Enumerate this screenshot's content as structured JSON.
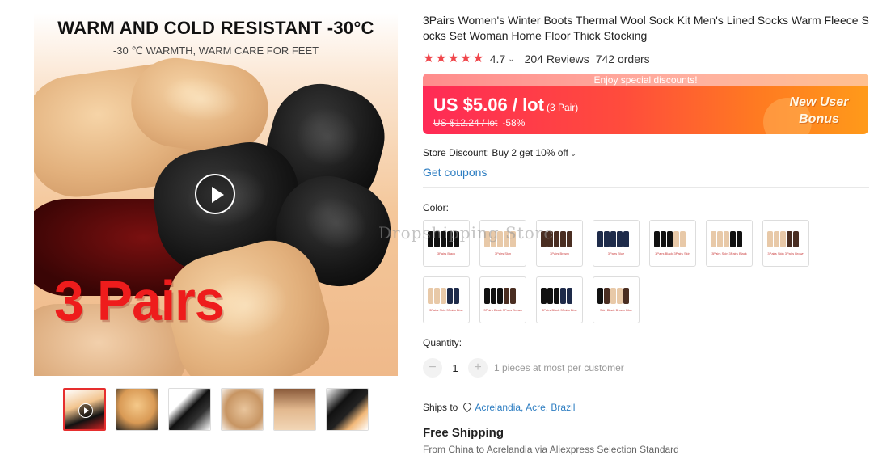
{
  "gallery": {
    "hero_title": "WARM AND COLD RESISTANT -30°C",
    "hero_subtitle": "-30 ℃ WARMTH, WARM CARE FOR FEET",
    "hero_overlay": "3 Pairs",
    "thumbnails": [
      "video",
      "beige-sock",
      "black-sock",
      "beige-sock-2",
      "socks-feet",
      "black-beige-sock"
    ]
  },
  "product": {
    "title": "3Pairs Women's Winter Boots Thermal Wool Sock Kit Men's Lined Socks Warm Fleece Socks Set Woman Home Floor Thick Stocking",
    "rating": "4.7",
    "reviews": "204 Reviews",
    "orders": "742 orders"
  },
  "price": {
    "banner": "Enjoy special discounts!",
    "current": "US $5.06 / lot",
    "unit": "(3 Pair)",
    "original": "US $12.24 / lot",
    "discount": "-58%",
    "promo_line1": "New User",
    "promo_line2": "Bonus",
    "accent": "#ff2a56"
  },
  "store": {
    "discount": "Store Discount: Buy 2 get 10% off",
    "coupons": "Get coupons"
  },
  "color": {
    "label": "Color:",
    "options": [
      {
        "caption": "3Pairs Black",
        "socks": [
          "#111",
          "#111",
          "#111",
          "#111",
          "#111"
        ]
      },
      {
        "caption": "3Pairs Skin",
        "socks": [
          "#e8c9a8",
          "#e8c9a8",
          "#e8c9a8",
          "#e8c9a8",
          "#e8c9a8"
        ]
      },
      {
        "caption": "3Pairs Brown",
        "socks": [
          "#4a2e22",
          "#4a2e22",
          "#4a2e22",
          "#4a2e22",
          "#4a2e22"
        ]
      },
      {
        "caption": "3Pairs Blue",
        "socks": [
          "#1e2b4a",
          "#1e2b4a",
          "#1e2b4a",
          "#1e2b4a",
          "#1e2b4a"
        ]
      },
      {
        "caption": "3Pairs Black 3Pairs Skin",
        "socks": [
          "#111",
          "#111",
          "#111",
          "#e8c9a8",
          "#e8c9a8"
        ]
      },
      {
        "caption": "3Pairs Skin 3Pairs Black",
        "socks": [
          "#e8c9a8",
          "#e8c9a8",
          "#e8c9a8",
          "#111",
          "#111"
        ]
      },
      {
        "caption": "3Pairs Skin 3Pairs Brown",
        "socks": [
          "#e8c9a8",
          "#e8c9a8",
          "#e8c9a8",
          "#4a2e22",
          "#4a2e22"
        ]
      },
      {
        "caption": "3Pairs Skin 3Pairs Blue",
        "socks": [
          "#e8c9a8",
          "#e8c9a8",
          "#e8c9a8",
          "#1e2b4a",
          "#1e2b4a"
        ]
      },
      {
        "caption": "3Pairs Black 3Pairs Brown",
        "socks": [
          "#111",
          "#111",
          "#111",
          "#4a2e22",
          "#4a2e22"
        ]
      },
      {
        "caption": "3Pairs Black 3Pairs Blue",
        "socks": [
          "#111",
          "#111",
          "#111",
          "#1e2b4a",
          "#1e2b4a"
        ]
      },
      {
        "caption": "Skin Black Brown Blue",
        "socks": [
          "#111",
          "#4a2e22",
          "#e8c9a8",
          "#e8c9a8",
          "#4a2e22"
        ]
      }
    ]
  },
  "quantity": {
    "label": "Quantity:",
    "value": "1",
    "minus": "−",
    "plus": "+",
    "note": "1 pieces at most per customer"
  },
  "shipping": {
    "ships_to_label": "Ships to",
    "location": "Acrelandia, Acre, Brazil",
    "method": "Free Shipping",
    "detail": "From China to Acrelandia via Aliexpress Selection Standard"
  },
  "watermark": "Dropshipping Store"
}
